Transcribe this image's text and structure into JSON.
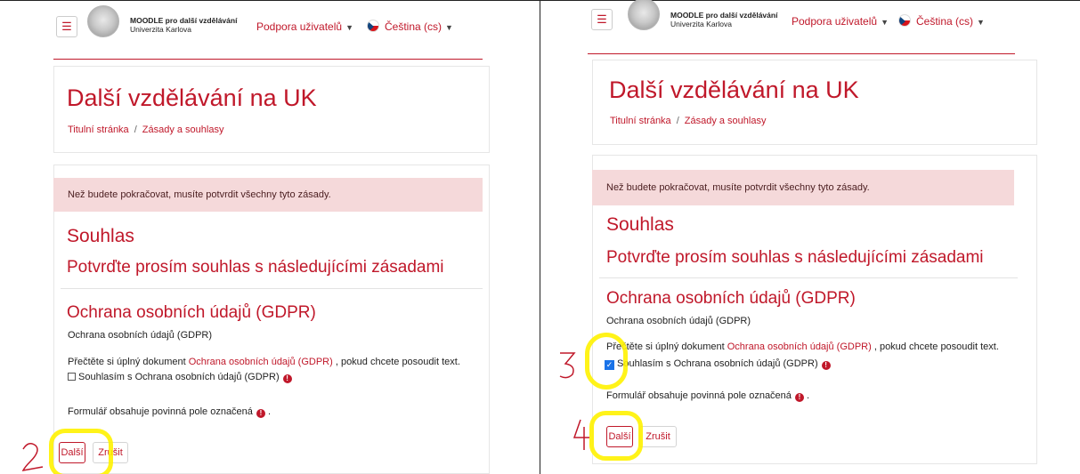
{
  "header": {
    "menu_icon": "hamburger-icon",
    "logo_icon": "university-seal-icon",
    "logo_line1": "MOODLE pro další vzdělávání",
    "logo_line2": "Univerzita Karlova",
    "support_menu": "Podpora uživatelů",
    "language_menu": "Čeština (cs)",
    "flag_icon": "czech-flag-icon",
    "accent_color": "#c0182a"
  },
  "page": {
    "title": "Další vzdělávání na UK",
    "breadcrumb_home": "Titulní stránka",
    "breadcrumb_current": "Zásady a souhlasy"
  },
  "form": {
    "alert": "Než budete pokračovat, musíte potvrdit všechny tyto zásady.",
    "heading": "Souhlas",
    "subheading": "Potvrďte prosím souhlas s následujícími zásadami",
    "policy_title": "Ochrana osobních údajů (GDPR)",
    "policy_summary": "Ochrana osobních údajů (GDPR)",
    "read_prefix": "Přečtěte si úplný dokument ",
    "read_link": "Ochrana osobních údajů (GDPR)",
    "read_suffix": " , pokud chcete posoudit text.",
    "agree_label": "Souhlasím s Ochrana osobních údajů (GDPR)",
    "required_note": "Formulář obsahuje povinná pole označená",
    "required_note_end": " .",
    "next_button": "Další",
    "cancel_button": "Zrušit"
  },
  "annotations": {
    "left_step": "2",
    "right_step_checkbox": "3",
    "right_step_button": "4",
    "highlight_color": "#fff200"
  },
  "state": {
    "left_checkbox_checked": false,
    "right_checkbox_checked": true
  }
}
